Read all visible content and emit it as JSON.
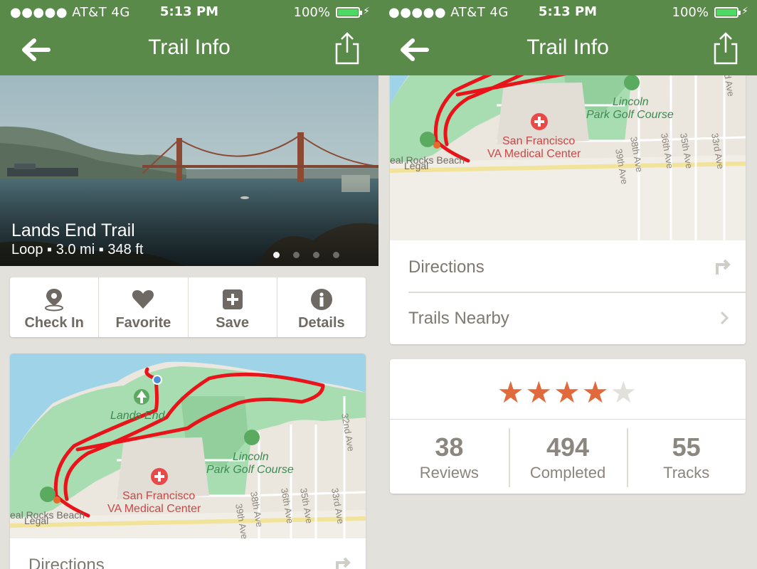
{
  "status_bar": {
    "carrier": "●●●●● AT&T  4G",
    "time": "5:13 PM",
    "battery": "100%"
  },
  "nav": {
    "title": "Trail Info"
  },
  "trail": {
    "name": "Lands End Trail",
    "meta": "Loop ▪ 3.0 mi ▪ 348 ft"
  },
  "actions": [
    {
      "label": "Check In",
      "icon": "location-pin-icon"
    },
    {
      "label": "Favorite",
      "icon": "heart-icon"
    },
    {
      "label": "Save",
      "icon": "plus-box-icon"
    },
    {
      "label": "Details",
      "icon": "info-icon"
    }
  ],
  "map": {
    "labels": {
      "lands_end": "Lands End",
      "lincoln": "Lincoln",
      "park_golf": "Park Golf Course",
      "sf": "San Francisco",
      "va": "VA Medical Center",
      "seal_rocks": "eal Rocks Beach",
      "legal": "Legal",
      "ave32": "32nd Ave",
      "ave33": "33rd Ave",
      "ave35": "35th Ave",
      "ave36": "36th Ave",
      "ave38": "38th Ave",
      "ave39": "39th Ave"
    }
  },
  "links": {
    "directions": "Directions",
    "trails_nearby": "Trails Nearby"
  },
  "rating": {
    "stars": 4,
    "max": 5
  },
  "stats": [
    {
      "value": "38",
      "label": "Reviews"
    },
    {
      "value": "494",
      "label": "Completed"
    },
    {
      "value": "55",
      "label": "Tracks"
    }
  ],
  "colors": {
    "header": "#5a8a4a",
    "star_on": "#e06a3b",
    "star_off": "#e2e0da",
    "trail": "#e8141a"
  }
}
